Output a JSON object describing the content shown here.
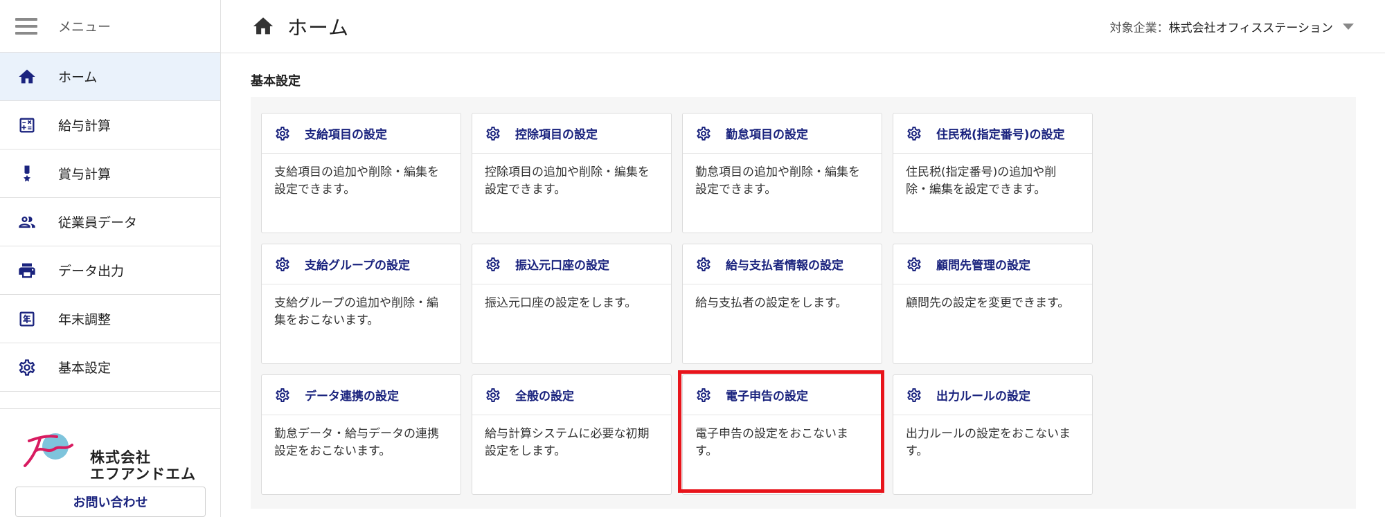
{
  "sidebar": {
    "menu_label": "メニュー",
    "items": [
      {
        "label": "ホーム",
        "icon": "home-icon",
        "active": true
      },
      {
        "label": "給与計算",
        "icon": "calculator-icon"
      },
      {
        "label": "賞与計算",
        "icon": "medal-icon"
      },
      {
        "label": "従業員データ",
        "icon": "people-icon"
      },
      {
        "label": "データ出力",
        "icon": "printer-icon"
      },
      {
        "label": "年末調整",
        "icon": "year-icon"
      },
      {
        "label": "基本設定",
        "icon": "gear-icon"
      }
    ],
    "logo_line1": "株式会社",
    "logo_line2": "エフアンドエム",
    "contact_label": "お問い合わせ"
  },
  "header": {
    "title": "ホーム",
    "company_label": "対象企業：",
    "company_name": "株式会社オフィスステーション"
  },
  "main": {
    "section_title": "基本設定",
    "cards": [
      {
        "title": "支給項目の設定",
        "desc": "支給項目の追加や削除・編集を設定できます。"
      },
      {
        "title": "控除項目の設定",
        "desc": "控除項目の追加や削除・編集を設定できます。"
      },
      {
        "title": "勤怠項目の設定",
        "desc": "勤怠項目の追加や削除・編集を設定できます。"
      },
      {
        "title": "住民税(指定番号)の設定",
        "desc": "住民税(指定番号)の追加や削除・編集を設定できます。"
      },
      {
        "title": "支給グループの設定",
        "desc": "支給グループの追加や削除・編集をおこないます。"
      },
      {
        "title": "振込元口座の設定",
        "desc": "振込元口座の設定をします。"
      },
      {
        "title": "給与支払者情報の設定",
        "desc": "給与支払者の設定をします。"
      },
      {
        "title": "顧問先管理の設定",
        "desc": "顧問先の設定を変更できます。"
      },
      {
        "title": "データ連携の設定",
        "desc": "勤怠データ・給与データの連携設定をおこないます。"
      },
      {
        "title": "全般の設定",
        "desc": "給与計算システムに必要な初期設定をします。"
      },
      {
        "title": "電子申告の設定",
        "desc": "電子申告の設定をおこないます。"
      },
      {
        "title": "出力ルールの設定",
        "desc": "出力ルールの設定をおこないます。"
      }
    ]
  },
  "colors": {
    "accent": "#1a237e",
    "active_bg": "#eaf2fb",
    "highlight": "#e8141b"
  }
}
